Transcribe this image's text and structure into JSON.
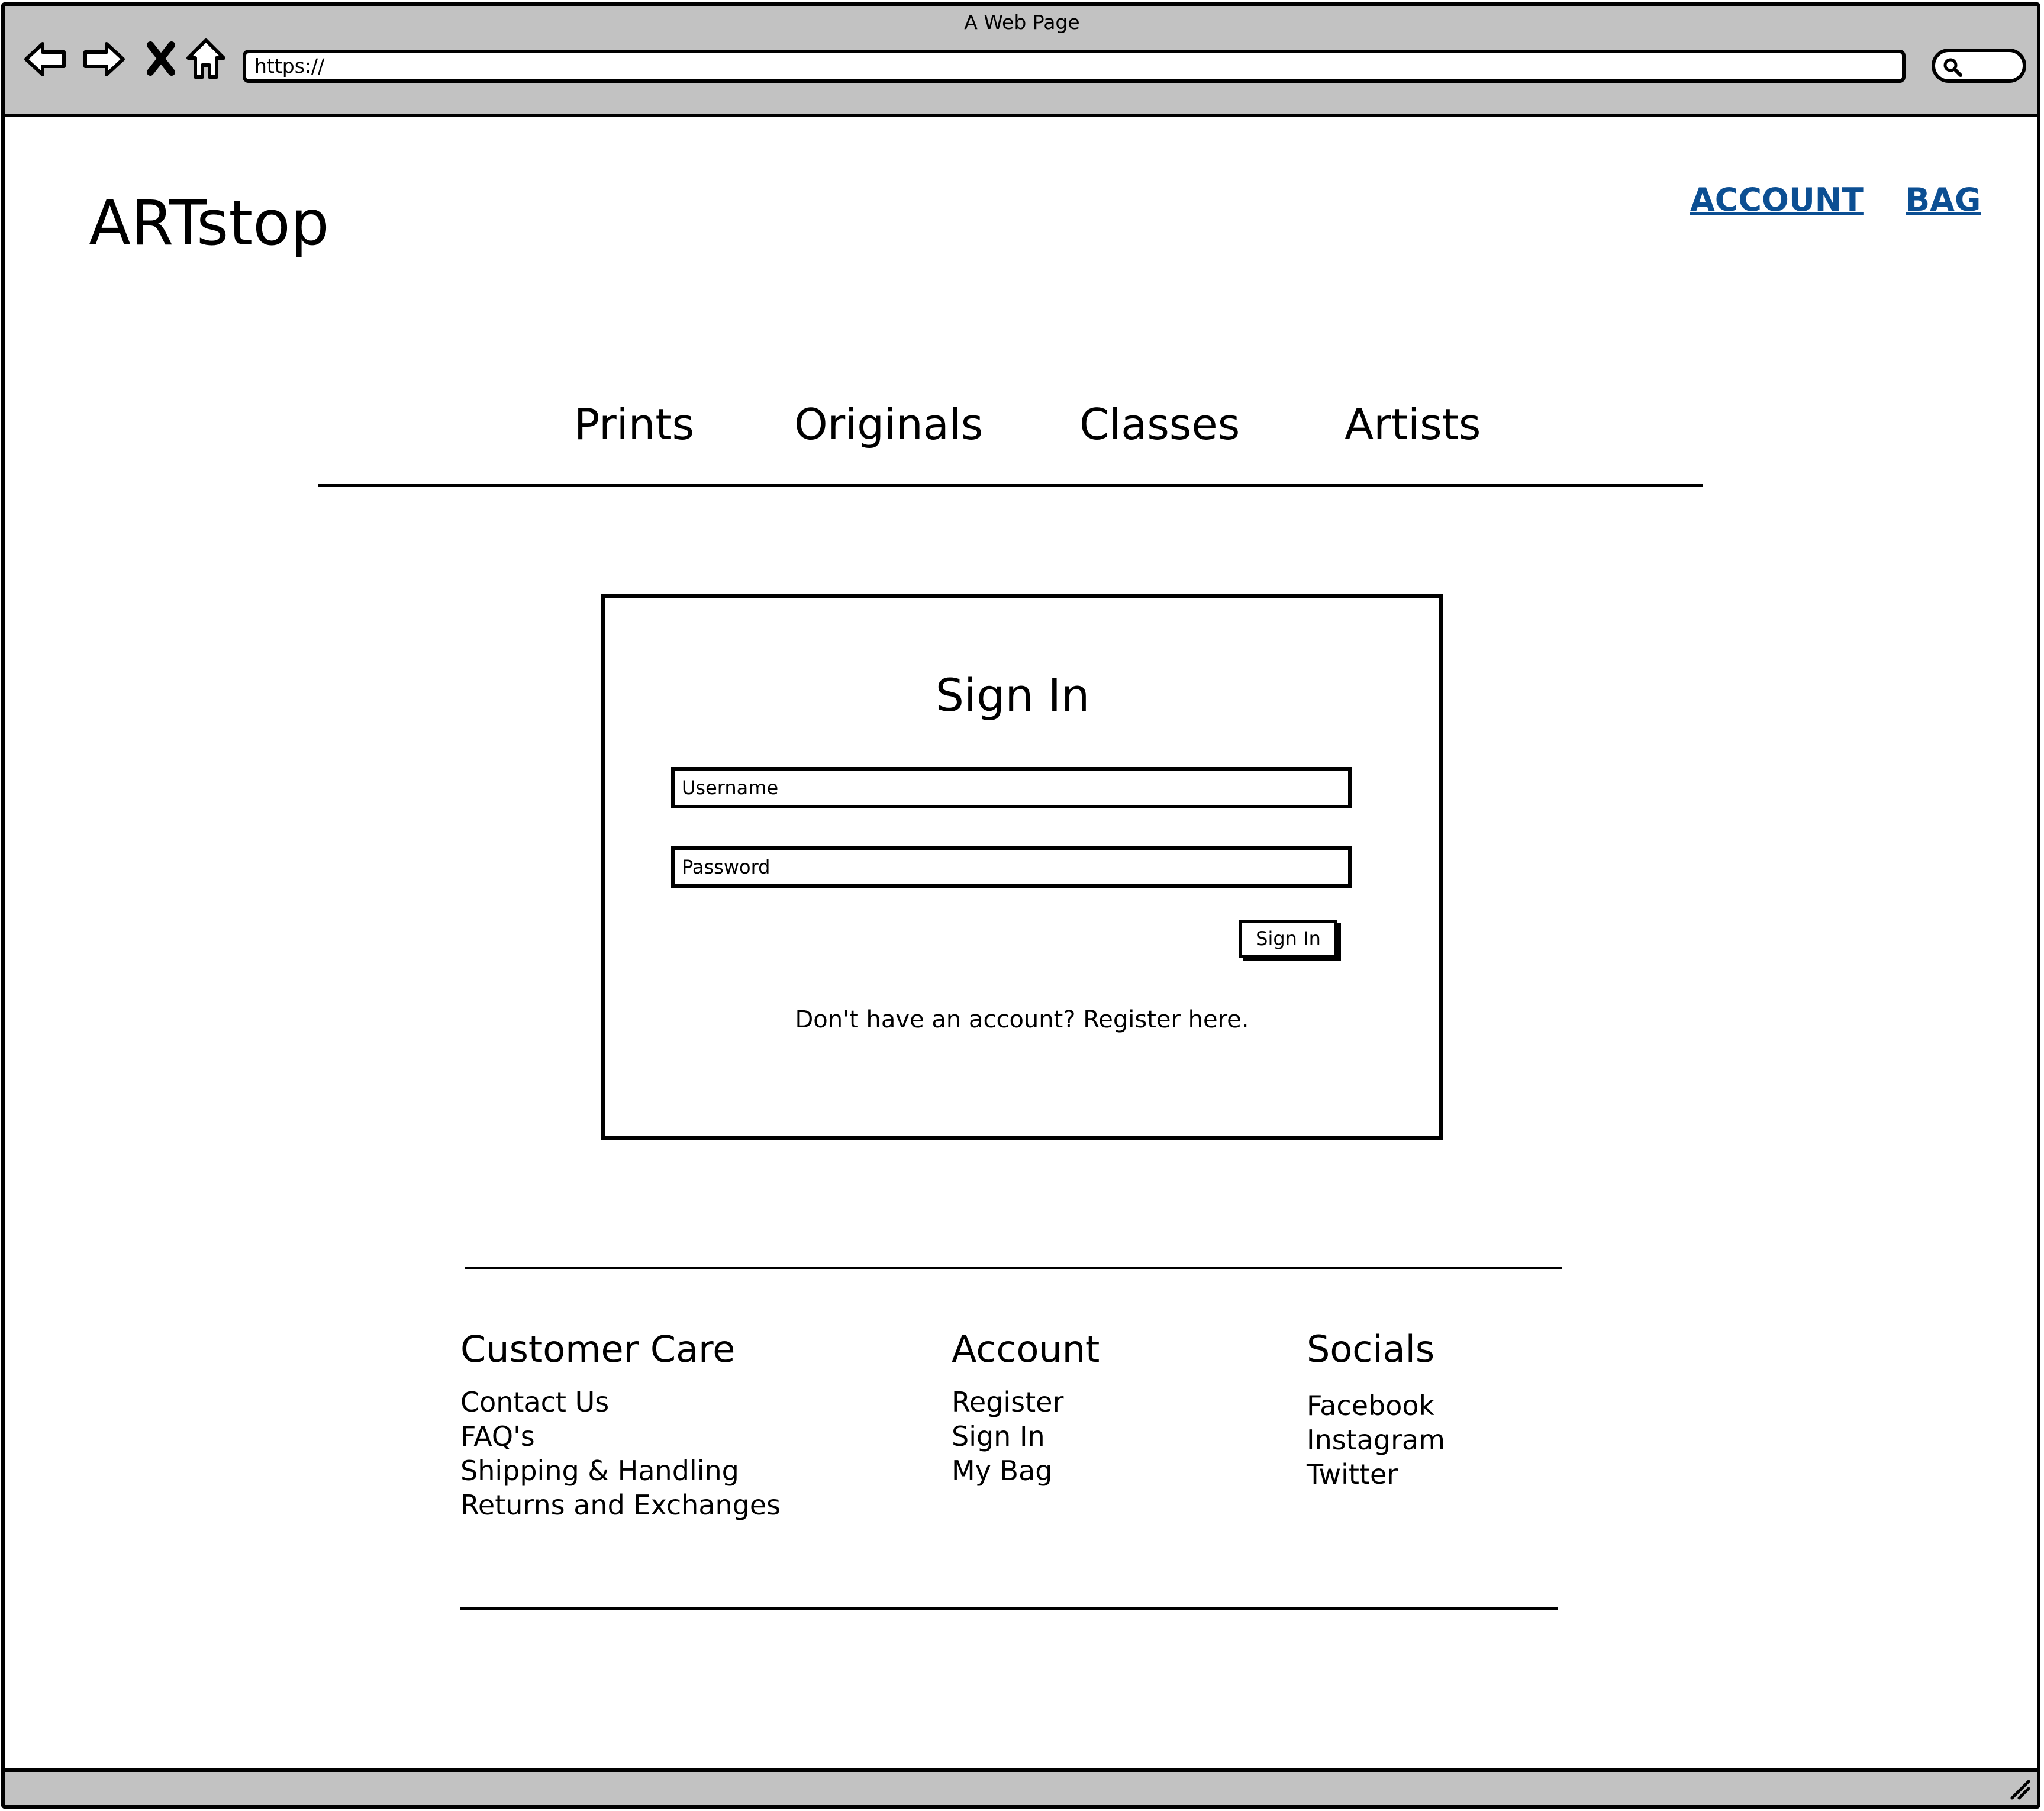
{
  "browser": {
    "window_title": "A Web Page",
    "url": "https://",
    "nav_icons": [
      "back-arrow-icon",
      "forward-arrow-icon",
      "close-x-icon",
      "home-icon",
      "search-icon"
    ]
  },
  "header": {
    "logo": "ARTstop",
    "links": {
      "account": "ACCOUNT",
      "bag": "BAG"
    },
    "link_color": "#0c4f93"
  },
  "nav": {
    "items": [
      "Prints",
      "Originals",
      "Classes",
      "Artists"
    ]
  },
  "signin": {
    "title": "Sign In",
    "username_placeholder": "Username",
    "password_placeholder": "Password",
    "button_label": "Sign In",
    "register_text": "Don't have an account? Register here."
  },
  "footer": {
    "customer_care": {
      "title": "Customer Care",
      "items": [
        "Contact Us",
        "FAQ's",
        "Shipping & Handling",
        "Returns and Exchanges"
      ]
    },
    "account": {
      "title": "Account",
      "items": [
        "Register",
        "Sign In",
        "My Bag"
      ]
    },
    "socials": {
      "title": "Socials",
      "items": [
        "Facebook",
        "Instagram",
        "Twitter"
      ]
    }
  },
  "colors": {
    "chrome_gray": "#c2c2c2"
  }
}
